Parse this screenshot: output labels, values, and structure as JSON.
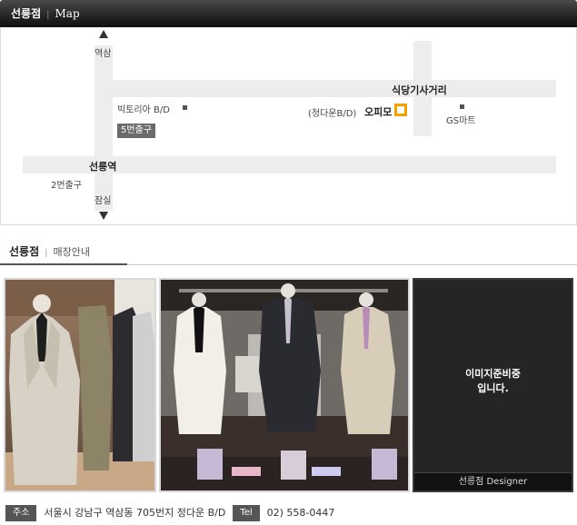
{
  "map_header": {
    "title": "선릉점",
    "separator": "|",
    "subtitle": "Map"
  },
  "map": {
    "north_label": "역삼",
    "south_label": "잠실",
    "intersection": "식당기사거리",
    "landmark_victoria": "빅토리아 B/D",
    "exit5": "5번출구",
    "store_building": "(청다운B/D)",
    "store_name": "오피모",
    "gs_mart": "GS마트",
    "station": "선릉역",
    "exit2": "2번출구"
  },
  "store_header": {
    "title": "선릉점",
    "separator": "|",
    "subtitle": "매장안내"
  },
  "photos": {
    "placeholder_line1": "이미지준비중",
    "placeholder_line2": "입니다.",
    "placeholder_caption": "선릉점 Designer"
  },
  "info": {
    "address_label": "주소",
    "address_value": "서울시 강남구 역삼동 705번지 정다운 B/D",
    "tel_label": "Tel",
    "tel_value": "02) 558-0447"
  },
  "colors": {
    "header_bg": "#222222",
    "store_marker": "#f4a000",
    "road": "#ededed"
  }
}
